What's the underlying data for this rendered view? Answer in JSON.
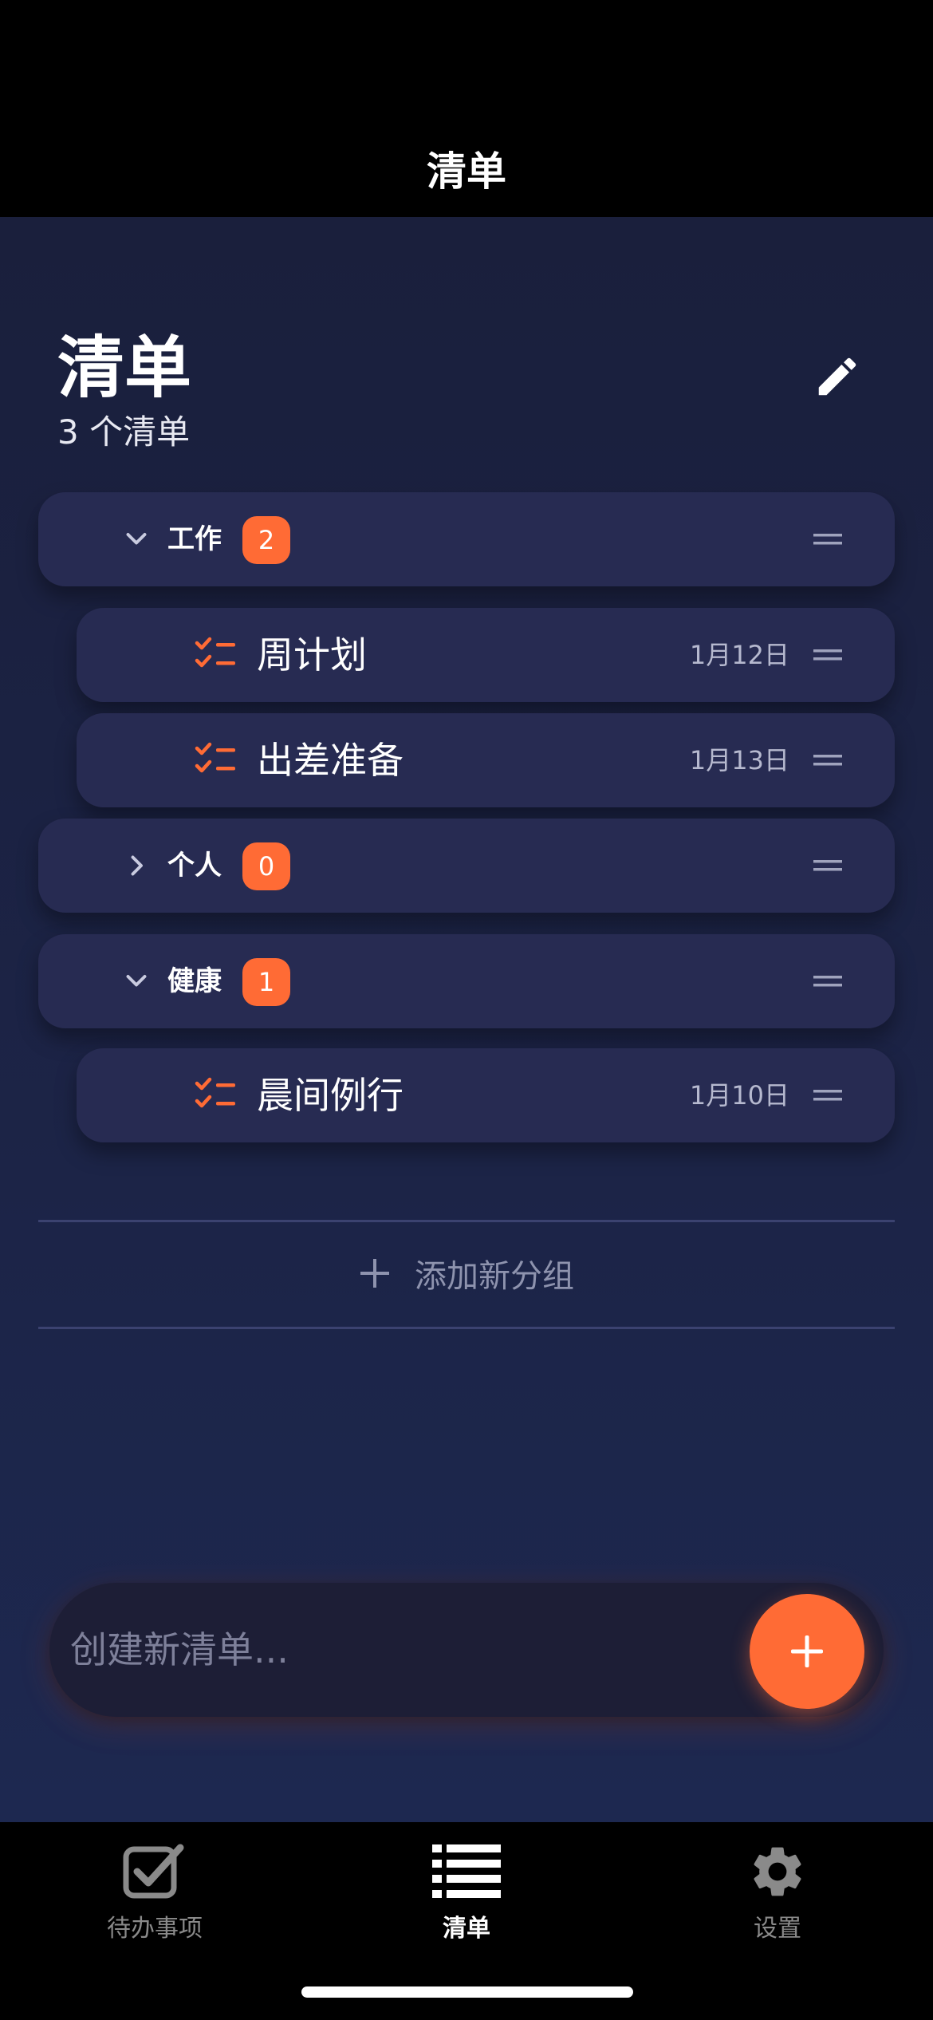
{
  "nav": {
    "title": "清单"
  },
  "header": {
    "title": "清单",
    "subtitle": "3 个清单",
    "edit_icon": "pencil-icon"
  },
  "groups": [
    {
      "name": "工作",
      "count": "2",
      "expanded": true,
      "lists": [
        {
          "title": "周计划",
          "date": "1月12日"
        },
        {
          "title": "出差准备",
          "date": "1月13日"
        }
      ]
    },
    {
      "name": "个人",
      "count": "0",
      "expanded": false,
      "lists": []
    },
    {
      "name": "健康",
      "count": "1",
      "expanded": true,
      "lists": [
        {
          "title": "晨间例行",
          "date": "1月10日"
        }
      ]
    }
  ],
  "add_group": {
    "label": "添加新分组"
  },
  "composer": {
    "placeholder": "创建新清单..."
  },
  "tabs": [
    {
      "label": "待办事项",
      "icon": "checkbox-icon",
      "active": false
    },
    {
      "label": "清单",
      "icon": "list-icon",
      "active": true
    },
    {
      "label": "设置",
      "icon": "gear-icon",
      "active": false
    }
  ],
  "colors": {
    "accent": "#ff6b35",
    "card": "#272b52",
    "background": "#1a1f3c"
  }
}
